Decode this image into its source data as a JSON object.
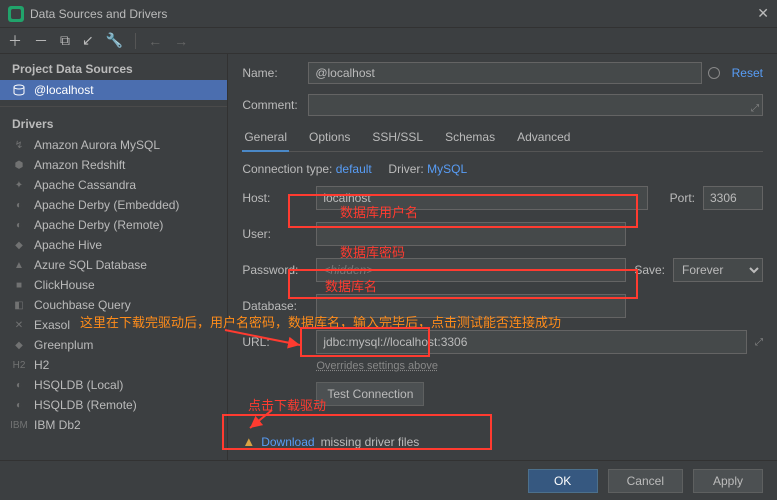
{
  "titlebar": {
    "title": "Data Sources and Drivers"
  },
  "sidebar": {
    "project_header": "Project Data Sources",
    "datasource": "@localhost",
    "drivers_header": "Drivers",
    "drivers": [
      "Amazon Aurora MySQL",
      "Amazon Redshift",
      "Apache Cassandra",
      "Apache Derby (Embedded)",
      "Apache Derby (Remote)",
      "Apache Hive",
      "Azure SQL Database",
      "ClickHouse",
      "Couchbase Query",
      "Exasol",
      "Greenplum",
      "H2",
      "HSQLDB (Local)",
      "HSQLDB (Remote)",
      "IBM Db2"
    ]
  },
  "form": {
    "name_label": "Name:",
    "name_value": "@localhost",
    "reset": "Reset",
    "comment_label": "Comment:",
    "tabs": [
      "General",
      "Options",
      "SSH/SSL",
      "Schemas",
      "Advanced"
    ],
    "conn_type_label": "Connection type:",
    "conn_type_value": "default",
    "driver_label": "Driver:",
    "driver_value": "MySQL",
    "host_label": "Host:",
    "host_value": "localhost",
    "port_label": "Port:",
    "port_value": "3306",
    "user_label": "User:",
    "password_label": "Password:",
    "password_placeholder": "<hidden>",
    "save_label": "Save:",
    "save_value": "Forever",
    "database_label": "Database:",
    "url_label": "URL:",
    "url_value": "jdbc:mysql://localhost:3306",
    "override": "Overrides settings above",
    "test_btn": "Test Connection",
    "download_link": "Download",
    "download_text": "missing driver files"
  },
  "footer": {
    "ok": "OK",
    "cancel": "Cancel",
    "apply": "Apply"
  },
  "annotations": {
    "user_hint": "数据库用户名",
    "pwd_hint": "数据库密码",
    "db_hint": "数据库名",
    "long_hint": "这里在下载完驱动后，用户名密码，数据库名，输入完毕后，点击测试能否连接成功",
    "dl_hint": "点击下载驱动"
  }
}
